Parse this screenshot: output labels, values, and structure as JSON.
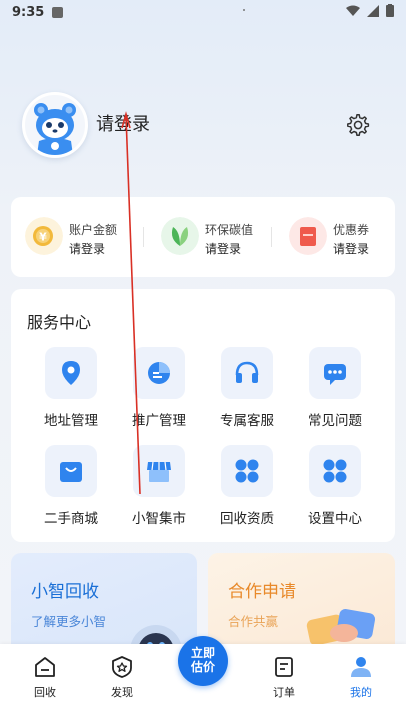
{
  "status_bar": {
    "time": "9:35"
  },
  "profile": {
    "login_text": "请登录"
  },
  "wallet": [
    {
      "label": "账户金额",
      "value": "请登录",
      "icon": "coin-icon"
    },
    {
      "label": "环保碳值",
      "value": "请登录",
      "icon": "leaf-icon"
    },
    {
      "label": "优惠券",
      "value": "请登录",
      "icon": "coupon-icon"
    }
  ],
  "service": {
    "title": "服务中心",
    "items": [
      {
        "label": "地址管理",
        "icon": "location-pin-icon"
      },
      {
        "label": "推广管理",
        "icon": "pie-chart-icon"
      },
      {
        "label": "专属客服",
        "icon": "headset-icon"
      },
      {
        "label": "常见问题",
        "icon": "chat-bubble-icon"
      },
      {
        "label": "二手商城",
        "icon": "shopping-bag-icon"
      },
      {
        "label": "小智集市",
        "icon": "storefront-icon"
      },
      {
        "label": "回收资质",
        "icon": "grid-icon"
      },
      {
        "label": "设置中心",
        "icon": "grid-icon"
      }
    ]
  },
  "promos": [
    {
      "title": "小智回收",
      "subtitle": "了解更多小智"
    },
    {
      "title": "合作申请",
      "subtitle": "合作共赢"
    }
  ],
  "tabs": [
    {
      "label": "回收",
      "icon": "home-icon"
    },
    {
      "label": "发现",
      "icon": "discover-icon"
    },
    {
      "label": "订单",
      "icon": "order-icon"
    },
    {
      "label": "我的",
      "icon": "profile-icon"
    }
  ],
  "center_button": {
    "line1": "立即",
    "line2": "估价"
  },
  "colors": {
    "accent": "#1a73e8",
    "promo_blue": "#1a6fd6",
    "promo_orange": "#e8892a"
  }
}
